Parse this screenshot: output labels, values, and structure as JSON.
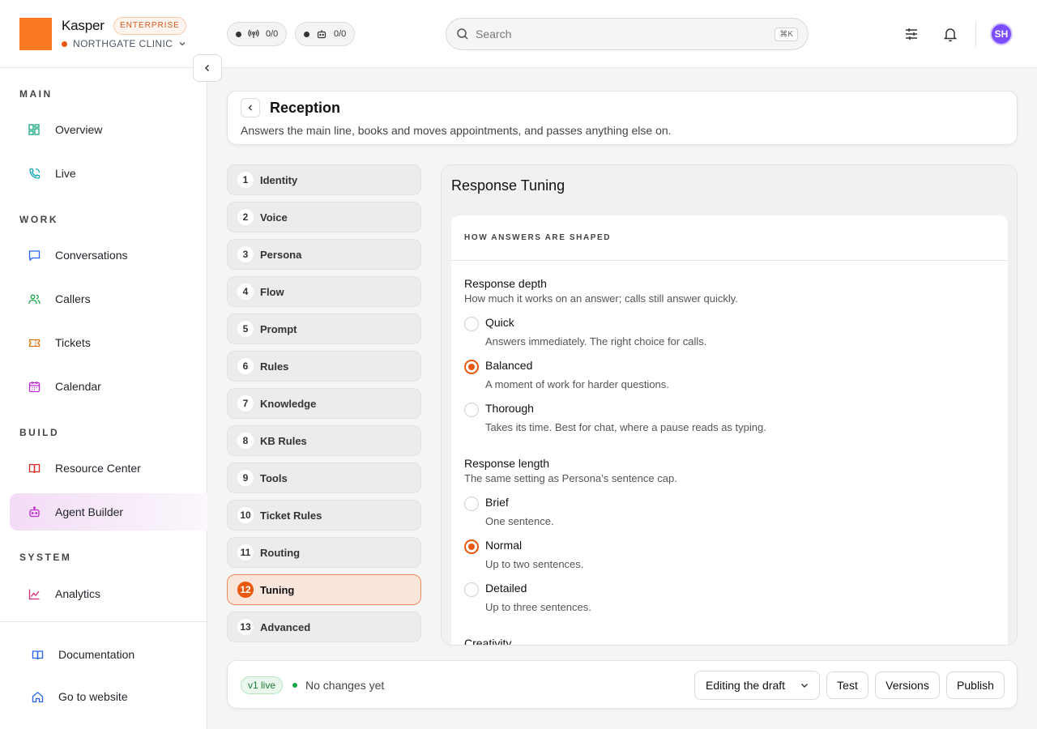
{
  "header": {
    "brand": "Kasper",
    "tier": "ENTERPRISE",
    "org": "NORTHGATE CLINIC",
    "status_pills": [
      {
        "icon": "broadcast-icon",
        "value": "0/0"
      },
      {
        "icon": "bot-icon",
        "value": "0/0"
      }
    ],
    "search": {
      "placeholder": "Search",
      "shortcut": "⌘K"
    },
    "avatar_initials": "SH"
  },
  "sidebar": {
    "sections": [
      {
        "label": "MAIN",
        "items": [
          {
            "label": "Overview",
            "icon": "grid-icon",
            "color": "#16a37f"
          },
          {
            "label": "Live",
            "icon": "phone-icon",
            "color": "#0ea5b7"
          }
        ]
      },
      {
        "label": "WORK",
        "items": [
          {
            "label": "Conversations",
            "icon": "chat-icon",
            "color": "#2563eb"
          },
          {
            "label": "Callers",
            "icon": "users-icon",
            "color": "#16a34a"
          },
          {
            "label": "Tickets",
            "icon": "ticket-icon",
            "color": "#d97706"
          },
          {
            "label": "Calendar",
            "icon": "calendar-icon",
            "color": "#c026d3"
          }
        ]
      },
      {
        "label": "BUILD",
        "items": [
          {
            "label": "Resource Center",
            "icon": "book-icon",
            "color": "#dc2626"
          },
          {
            "label": "Agent Builder",
            "icon": "bot-icon",
            "color": "#c026d3",
            "active": true
          }
        ]
      },
      {
        "label": "SYSTEM",
        "items": [
          {
            "label": "Analytics",
            "icon": "chart-icon",
            "color": "#db2777"
          }
        ]
      }
    ],
    "footer_items": [
      {
        "label": "Documentation",
        "icon": "book-open-icon",
        "color": "#2563eb"
      },
      {
        "label": "Go to website",
        "icon": "home-icon",
        "color": "#2563eb"
      }
    ]
  },
  "page": {
    "title": "Reception",
    "description": "Answers the main line, books and moves appointments, and passes anything else on."
  },
  "steps": [
    {
      "num": "1",
      "label": "Identity"
    },
    {
      "num": "2",
      "label": "Voice"
    },
    {
      "num": "3",
      "label": "Persona"
    },
    {
      "num": "4",
      "label": "Flow"
    },
    {
      "num": "5",
      "label": "Prompt"
    },
    {
      "num": "6",
      "label": "Rules"
    },
    {
      "num": "7",
      "label": "Knowledge"
    },
    {
      "num": "8",
      "label": "KB Rules"
    },
    {
      "num": "9",
      "label": "Tools"
    },
    {
      "num": "10",
      "label": "Ticket Rules"
    },
    {
      "num": "11",
      "label": "Routing"
    },
    {
      "num": "12",
      "label": "Tuning",
      "active": true
    },
    {
      "num": "13",
      "label": "Advanced"
    }
  ],
  "panel": {
    "title": "Response Tuning",
    "card_heading": "HOW ANSWERS ARE SHAPED",
    "groups": [
      {
        "title": "Response depth",
        "description": "How much it works on an answer; calls still answer quickly.",
        "options": [
          {
            "label": "Quick",
            "description": "Answers immediately. The right choice for calls.",
            "checked": false
          },
          {
            "label": "Balanced",
            "description": "A moment of work for harder questions.",
            "checked": true
          },
          {
            "label": "Thorough",
            "description": "Takes its time. Best for chat, where a pause reads as typing.",
            "checked": false
          }
        ]
      },
      {
        "title": "Response length",
        "description": "The same setting as Persona’s sentence cap.",
        "options": [
          {
            "label": "Brief",
            "description": "One sentence.",
            "checked": false
          },
          {
            "label": "Normal",
            "description": "Up to two sentences.",
            "checked": true
          },
          {
            "label": "Detailed",
            "description": "Up to three sentences.",
            "checked": false
          }
        ]
      },
      {
        "title": "Creativity",
        "description": "",
        "options": []
      }
    ]
  },
  "footer": {
    "version": "v1 live",
    "status": "No changes yet",
    "mode_select": "Editing the draft",
    "buttons": {
      "test": "Test",
      "versions": "Versions",
      "publish": "Publish"
    }
  },
  "colors": {
    "accent": "#ea580c",
    "brand": "#fb7a21",
    "live_green": "#16a34a",
    "avatar": "#7c4dff"
  }
}
